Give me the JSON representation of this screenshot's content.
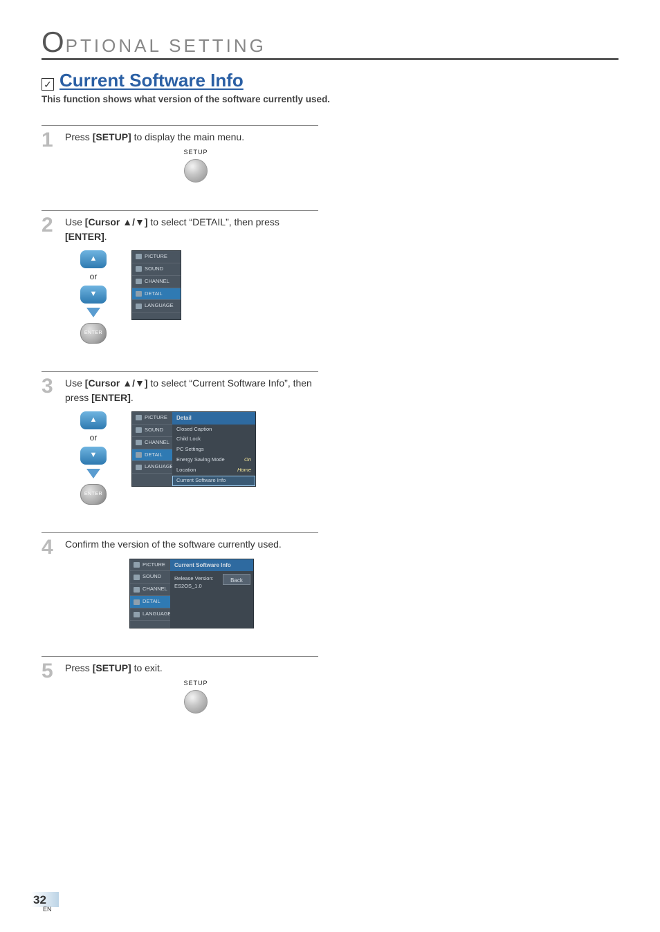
{
  "chapter": {
    "initial": "O",
    "rest": "PTIONAL  SETTING"
  },
  "section": {
    "check_glyph": "✓",
    "title": "Current Software Info",
    "subtitle": "This function shows what version of the software currently used."
  },
  "steps": {
    "s1": {
      "num": "1",
      "text_pre": "Press ",
      "text_bold": "[SETUP]",
      "text_post": " to display the main menu.",
      "btn_label": "SETUP"
    },
    "s2": {
      "num": "2",
      "text_pre": "Use ",
      "text_bold": "[Cursor ▲/▼]",
      "text_mid": " to select “DETAIL”, then press ",
      "text_bold2": "[ENTER]",
      "text_post": ".",
      "or": "or",
      "enter": "ENTER",
      "osd": {
        "items": [
          "PICTURE",
          "SOUND",
          "CHANNEL",
          "DETAIL",
          "LANGUAGE"
        ],
        "selected_index": 3
      }
    },
    "s3": {
      "num": "3",
      "text_pre": "Use ",
      "text_bold": "[Cursor ▲/▼]",
      "text_mid": " to select “Current Software Info”, then press ",
      "text_bold2": "[ENTER]",
      "text_post": ".",
      "or": "or",
      "enter": "ENTER",
      "osd": {
        "side": [
          "PICTURE",
          "SOUND",
          "CHANNEL",
          "DETAIL",
          "LANGUAGE"
        ],
        "side_sel": 3,
        "title": "Detail",
        "items": [
          {
            "label": "Closed Caption",
            "val": ""
          },
          {
            "label": "Child Lock",
            "val": ""
          },
          {
            "label": "PC Settings",
            "val": ""
          },
          {
            "label": "Energy Saving Mode",
            "val": "On"
          },
          {
            "label": "Location",
            "val": "Home"
          },
          {
            "label": "Current Software Info",
            "val": ""
          }
        ],
        "sel_index": 5
      }
    },
    "s4": {
      "num": "4",
      "text": "Confirm the version of the software currently used.",
      "osd": {
        "side": [
          "PICTURE",
          "SOUND",
          "CHANNEL",
          "DETAIL",
          "LANGUAGE"
        ],
        "side_sel": 3,
        "title": "Current Software Info",
        "back": "Back",
        "line1": "Release Version:",
        "line2": "ES2OS_1.0"
      }
    },
    "s5": {
      "num": "5",
      "text_pre": "Press ",
      "text_bold": "[SETUP]",
      "text_post": " to exit.",
      "btn_label": "SETUP"
    }
  },
  "footer": {
    "page": "32",
    "lang": "EN"
  }
}
